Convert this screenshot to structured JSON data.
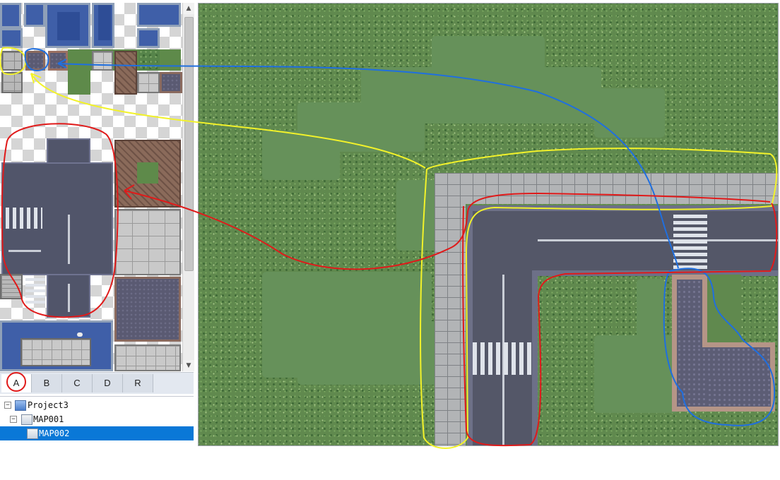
{
  "tileset": {
    "tabs": [
      {
        "label": "A",
        "active": true
      },
      {
        "label": "B",
        "active": false
      },
      {
        "label": "C",
        "active": false
      },
      {
        "label": "D",
        "active": false
      },
      {
        "label": "R",
        "active": false
      }
    ],
    "scroll_up": "▲",
    "scroll_down": "▼"
  },
  "project_tree": {
    "project": {
      "label": "Project3",
      "expander": "−"
    },
    "map1": {
      "label": "MAP001",
      "expander": "−"
    },
    "map2": {
      "label": "MAP002",
      "selected": true
    }
  },
  "colors": {
    "annotation_yellow": "#f2f22a",
    "annotation_blue": "#1f6fe0",
    "annotation_red": "#e01a1a",
    "selection_blue": "#0a78d7"
  }
}
